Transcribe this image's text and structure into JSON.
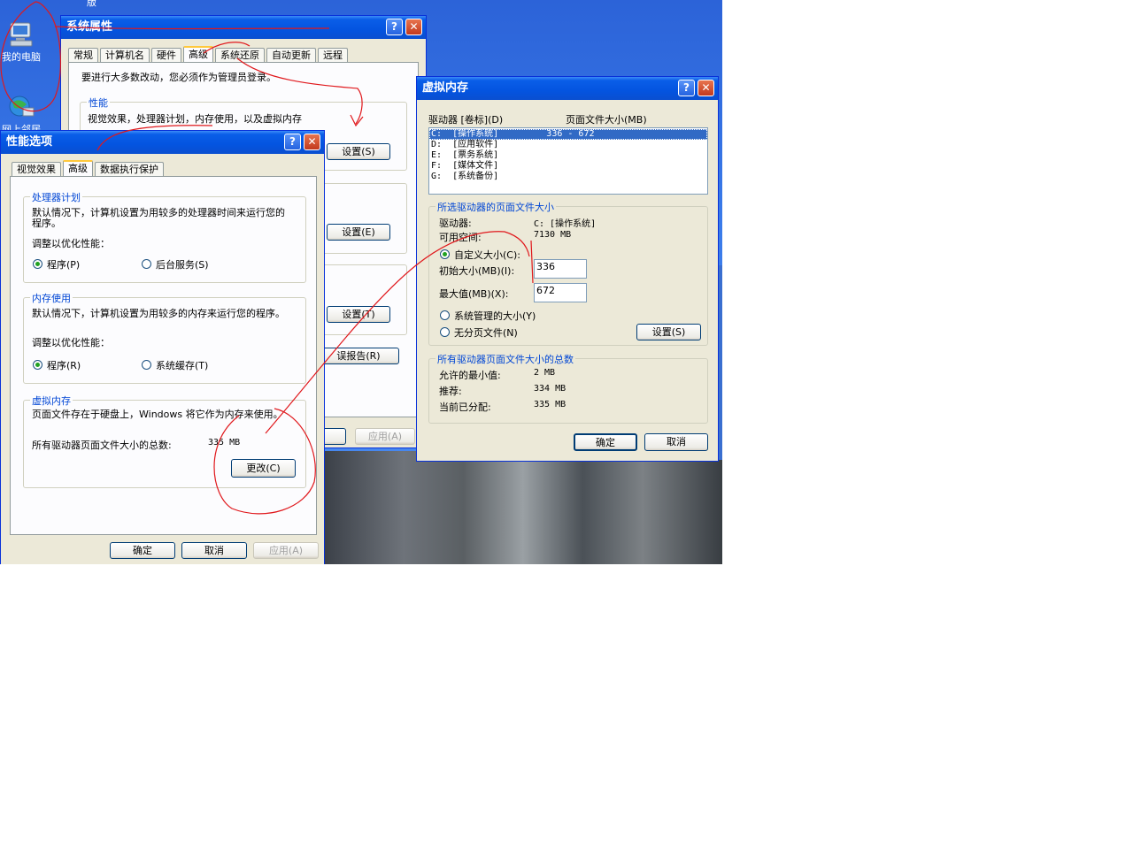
{
  "desktop": {
    "icons": [
      {
        "label": "我的电脑",
        "icon": "computer-icon"
      },
      {
        "label": "网上邻居",
        "icon": "network-icon"
      }
    ],
    "top_text": "版"
  },
  "sys_props": {
    "title": "系统属性",
    "tabs": [
      "常规",
      "计算机名",
      "硬件",
      "高级",
      "系统还原",
      "自动更新",
      "远程"
    ],
    "active_tab": "高级",
    "admin_note": "要进行大多数改动，您必须作为管理员登录。",
    "perf_group": "性能",
    "perf_desc": "视觉效果，处理器计划，内存使用，以及虚拟内存",
    "settings1": "设置(S)",
    "settings2": "设置(E)",
    "settings3": "设置(T)",
    "error_report": "误报告(R)",
    "apply": "应用(A)"
  },
  "perf_opts": {
    "title": "性能选项",
    "tabs": [
      "视觉效果",
      "高级",
      "数据执行保护"
    ],
    "active_tab": "高级",
    "proc_group": "处理器计划",
    "proc_desc": "默认情况下，计算机设置为用较多的处理器时间来运行您的程序。",
    "proc_adjust": "调整以优化性能：",
    "proc_opt1": "程序(P)",
    "proc_opt2": "后台服务(S)",
    "mem_group": "内存使用",
    "mem_desc": "默认情况下，计算机设置为用较多的内存来运行您的程序。",
    "mem_adjust": "调整以优化性能：",
    "mem_opt1": "程序(R)",
    "mem_opt2": "系统缓存(T)",
    "vm_group": "虚拟内存",
    "vm_desc": "页面文件存在于硬盘上，Windows 将它作为内存来使用。",
    "vm_total_label": "所有驱动器页面文件大小的总数:",
    "vm_total_value": "335 MB",
    "change_button": "更改(C)",
    "ok": "确定",
    "cancel": "取消",
    "apply": "应用(A)"
  },
  "virt_mem": {
    "title": "虚拟内存",
    "col_drive": "驱动器 [卷标](D)",
    "col_size": "页面文件大小(MB)",
    "drives": [
      {
        "text": "C:  [操作系统]         336 - 672",
        "selected": true
      },
      {
        "text": "D:  [应用软件]",
        "selected": false
      },
      {
        "text": "E:  [票务系统]",
        "selected": false
      },
      {
        "text": "F:  [媒体文件]",
        "selected": false
      },
      {
        "text": "G:  [系统备份]",
        "selected": false
      }
    ],
    "sel_group": "所选驱动器的页面文件大小",
    "drive_label": "驱动器:",
    "drive_value": "C:  [操作系统]",
    "space_label": "可用空间:",
    "space_value": "7130 MB",
    "custom_size": "自定义大小(C):",
    "initial_label": "初始大小(MB)(I):",
    "initial_value": "336",
    "max_label": "最大值(MB)(X):",
    "max_value": "672",
    "system_managed": "系统管理的大小(Y)",
    "no_paging": "无分页文件(N)",
    "set_button": "设置(S)",
    "total_group": "所有驱动器页面文件大小的总数",
    "min_label": "允许的最小值:",
    "min_value": "2 MB",
    "rec_label": "推荐:",
    "rec_value": "334 MB",
    "cur_label": "当前已分配:",
    "cur_value": "335 MB",
    "ok": "确定",
    "cancel": "取消"
  },
  "colors": {
    "title_blue": "#0454e0",
    "window_face": "#ece9d8",
    "group_title": "#0046d5",
    "ink": "#e0181c"
  }
}
